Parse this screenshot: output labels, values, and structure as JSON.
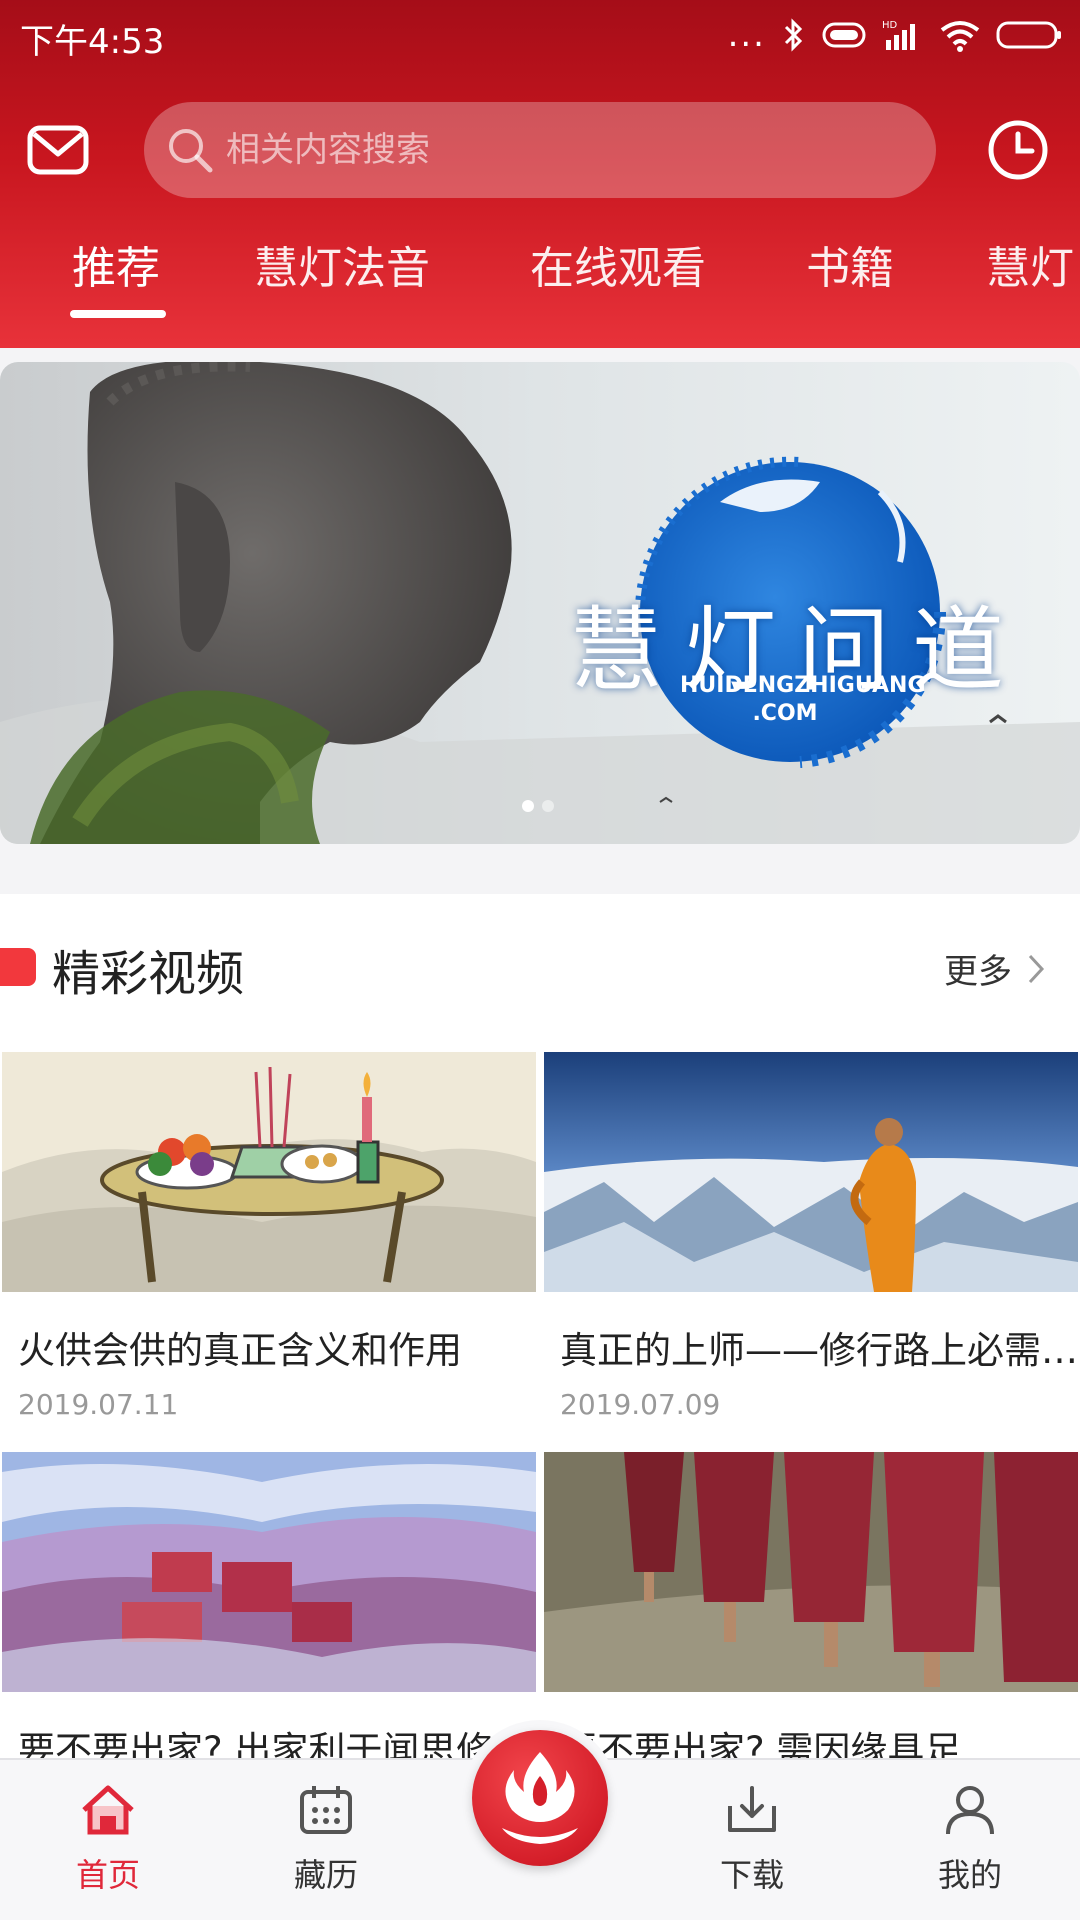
{
  "status": {
    "time": "下午4:53",
    "dots": "..."
  },
  "header": {
    "search_placeholder": "相关内容搜索",
    "tabs": [
      {
        "label": "推荐"
      },
      {
        "label": "慧灯法音"
      },
      {
        "label": "在线观看"
      },
      {
        "label": "书籍"
      },
      {
        "label": "慧灯"
      }
    ]
  },
  "banner": {
    "title": "慧灯问道",
    "domain_line1": "HUIDENGZHIGUANG",
    "domain_line2": ".COM",
    "slide_count": 2,
    "active_slide": 1
  },
  "section": {
    "title": "精彩视频",
    "more_label": "更多"
  },
  "videos": [
    {
      "title": "火供会供的真正含义和作用",
      "date": "2019.07.11"
    },
    {
      "title": "真正的上师——修行路上必需的…",
      "date": "2019.07.09"
    },
    {
      "title": "要不要出家? 出家利于闻思修…",
      "date": ""
    },
    {
      "title": "要不要出家? 需因缘具足",
      "date": ""
    }
  ],
  "bottom_nav": {
    "items": [
      {
        "label": "首页",
        "icon": "home-icon"
      },
      {
        "label": "藏历",
        "icon": "calendar-icon"
      },
      {
        "label": "",
        "icon": "lamp-logo-icon"
      },
      {
        "label": "下载",
        "icon": "download-icon"
      },
      {
        "label": "我的",
        "icon": "user-icon"
      }
    ]
  },
  "colors": {
    "brand_red": "#d51f2a",
    "active_nav": "#e0283a",
    "section_mark": "#f2383d"
  }
}
